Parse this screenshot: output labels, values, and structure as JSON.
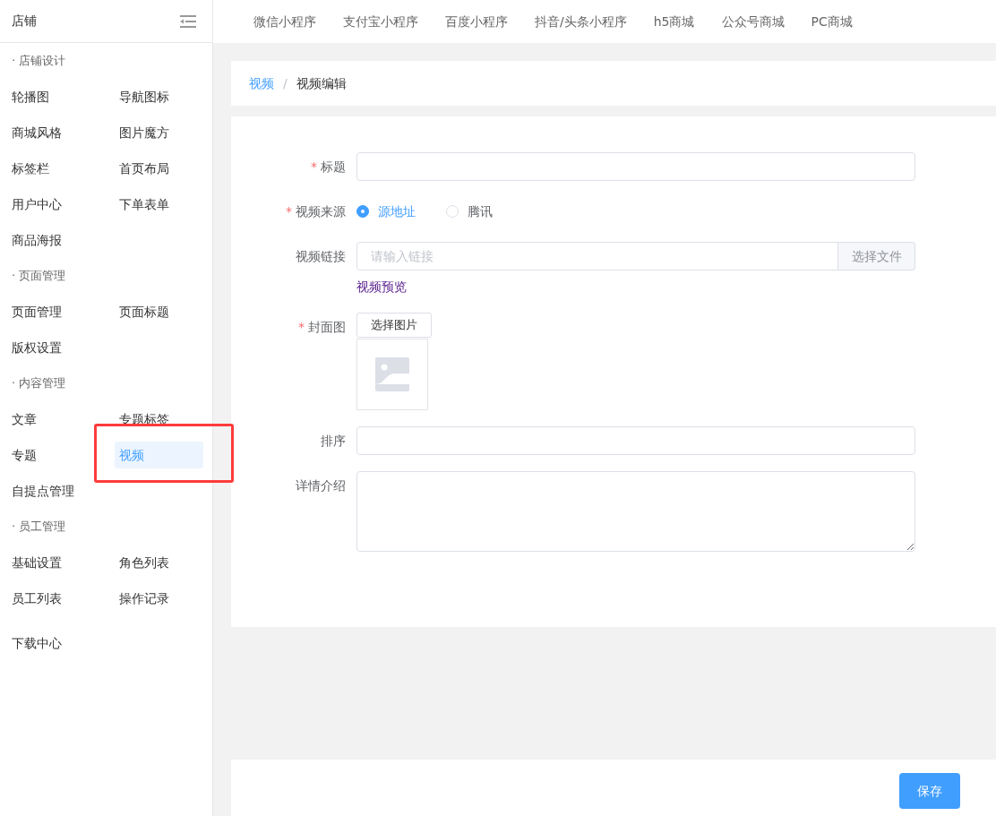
{
  "sidebar": {
    "title": "店铺",
    "groups": [
      {
        "heading": "· 店铺设计",
        "items": [
          {
            "label": "轮播图",
            "selected": false,
            "annotated": false
          },
          {
            "label": "导航图标",
            "selected": false,
            "annotated": false
          },
          {
            "label": "商城风格",
            "selected": false,
            "annotated": false
          },
          {
            "label": "图片魔方",
            "selected": false,
            "annotated": false
          },
          {
            "label": "标签栏",
            "selected": false,
            "annotated": false
          },
          {
            "label": "首页布局",
            "selected": false,
            "annotated": false
          },
          {
            "label": "用户中心",
            "selected": false,
            "annotated": false
          },
          {
            "label": "下单表单",
            "selected": false,
            "annotated": false
          },
          {
            "label": "商品海报",
            "selected": false,
            "annotated": false
          }
        ]
      },
      {
        "heading": "· 页面管理",
        "items": [
          {
            "label": "页面管理",
            "selected": false,
            "annotated": false
          },
          {
            "label": "页面标题",
            "selected": false,
            "annotated": false
          },
          {
            "label": "版权设置",
            "selected": false,
            "annotated": false
          }
        ]
      },
      {
        "heading": "· 内容管理",
        "items": [
          {
            "label": "文章",
            "selected": false,
            "annotated": false
          },
          {
            "label": "专题标签",
            "selected": false,
            "annotated": false
          },
          {
            "label": "专题",
            "selected": false,
            "annotated": false
          },
          {
            "label": "视频",
            "selected": true,
            "annotated": true
          },
          {
            "label": "自提点管理",
            "selected": false,
            "annotated": false
          }
        ]
      },
      {
        "heading": "· 员工管理",
        "items": [
          {
            "label": "基础设置",
            "selected": false,
            "annotated": false
          },
          {
            "label": "角色列表",
            "selected": false,
            "annotated": false
          },
          {
            "label": "员工列表",
            "selected": false,
            "annotated": false
          },
          {
            "label": "操作记录",
            "selected": false,
            "annotated": false
          }
        ]
      },
      {
        "items": [
          {
            "label": "下载中心",
            "selected": false,
            "annotated": false
          }
        ]
      }
    ]
  },
  "top_tabs": [
    "微信小程序",
    "支付宝小程序",
    "百度小程序",
    "抖音/头条小程序",
    "h5商城",
    "公众号商城",
    "PC商城"
  ],
  "breadcrumb": {
    "separator": "/",
    "items": [
      {
        "label": "视频",
        "kind": "link"
      },
      {
        "label": "视频编辑",
        "kind": "current"
      }
    ]
  },
  "form": {
    "fields": [
      {
        "kind": "text",
        "label": "标题",
        "marker": "*"
      },
      {
        "kind": "radio",
        "label": "视频来源",
        "marker": "*",
        "options": [
          {
            "label": "源地址",
            "selected": true
          },
          {
            "label": "腾讯",
            "selected": false
          }
        ]
      },
      {
        "kind": "file-link",
        "label": "视频链接",
        "placeholder": "请输入链接",
        "button": "选择文件",
        "link": "视频预览"
      },
      {
        "kind": "image",
        "label": "封面图",
        "marker": "*",
        "button": "选择图片"
      },
      {
        "kind": "text",
        "label": "排序"
      },
      {
        "kind": "textarea",
        "label": "详情介绍"
      }
    ]
  },
  "footer": {
    "save_button": "保存"
  }
}
